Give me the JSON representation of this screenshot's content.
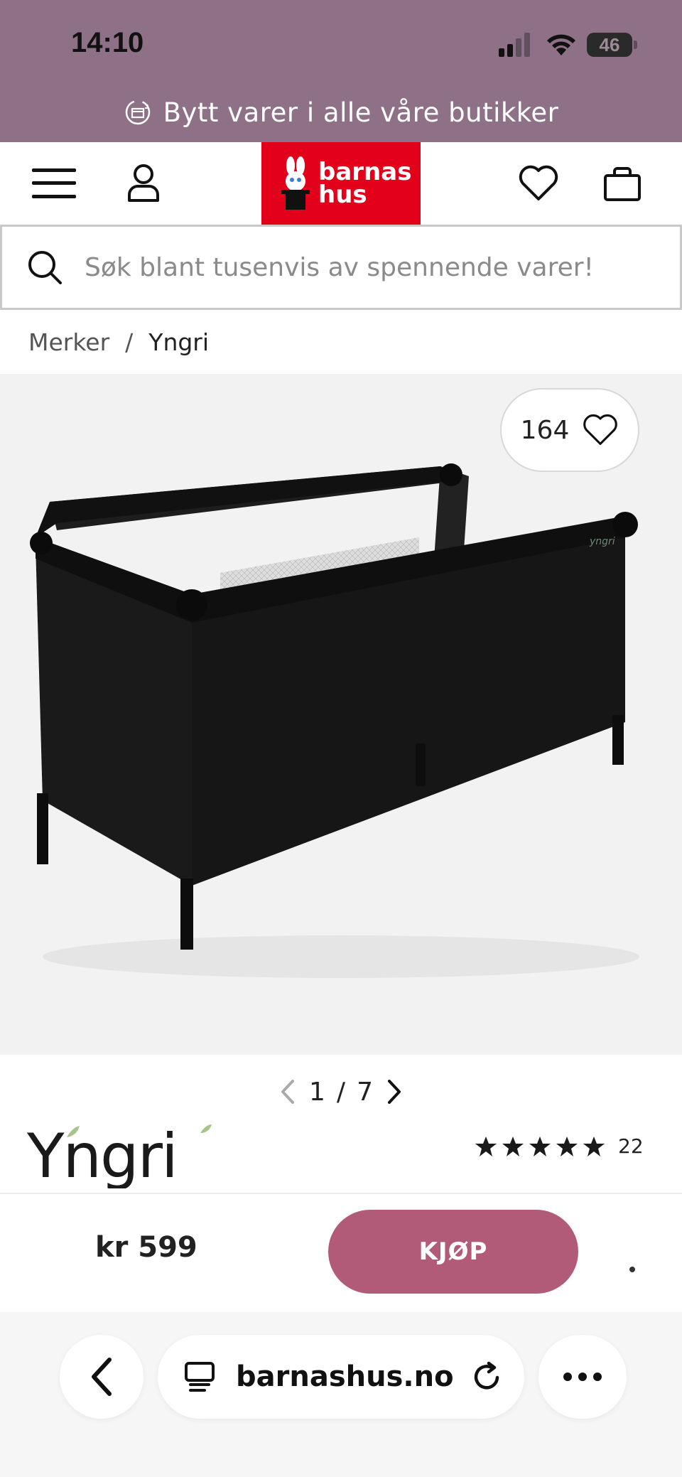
{
  "status_bar": {
    "time": "14:10",
    "battery": "46"
  },
  "promo": {
    "text": "Bytt varer i alle våre butikker",
    "icon": "exchange-box-icon"
  },
  "header": {
    "menu_icon": "hamburger-menu-icon",
    "account_icon": "user-icon",
    "logo_line1": "barnas",
    "logo_line2": "hus",
    "wishlist_icon": "heart-icon",
    "cart_icon": "shopping-bag-icon"
  },
  "search": {
    "placeholder": "Søk blant tusenvis av spennende varer!"
  },
  "breadcrumb": {
    "items": [
      "Merker"
    ],
    "separator": "/",
    "current": "Yngri"
  },
  "gallery": {
    "favorite_count": "164",
    "current": "1",
    "separator": "/",
    "total": "7"
  },
  "product": {
    "brand": "Yngri",
    "rating": 5,
    "rating_count": "22",
    "price": "kr 599",
    "buy_label": "KJØP"
  },
  "browser": {
    "url": "barnashus.no"
  },
  "colors": {
    "promo_bg": "#8e7187",
    "brand_red": "#e3001b",
    "buy_button": "#b25b79",
    "brand_leaf": "#a8c48a"
  }
}
